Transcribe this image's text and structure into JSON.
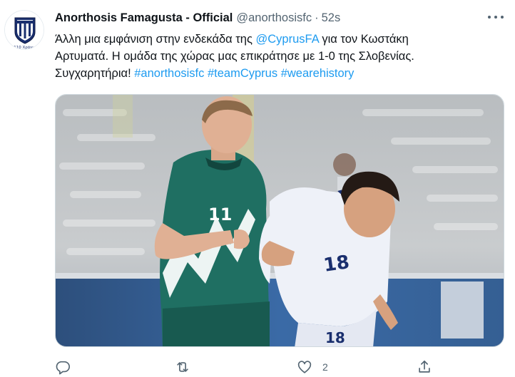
{
  "tweet": {
    "display_name": "Anorthosis Famagusta - Official",
    "handle": "@anorthosisfc",
    "separator": "·",
    "time": "52s",
    "text": {
      "l1_a": "Άλλη μια εμφάνιση στην ενδεκάδα της ",
      "l1_mention": "@CyprusFA",
      "l1_b": " για τον Κωστάκη",
      "l2": "Αρτυματά. Η ομάδα της χώρας μας επικράτησε με 1-0 της Σλοβενίας.",
      "l3_a": "Συγχαρητήρια! ",
      "hashtags": [
        "#anorthosisfc",
        "#teamCyprus",
        "#wearehistory"
      ]
    },
    "avatar": {
      "icon": "club-crest-icon",
      "caption": "110 Χρόνια"
    },
    "media": {
      "jersey_numbers": [
        "11",
        "18",
        "18"
      ]
    },
    "actions": {
      "reply_icon": "reply-icon",
      "retweet_icon": "retweet-icon",
      "like_icon": "heart-icon",
      "like_count": "2",
      "share_icon": "share-icon"
    },
    "colors": {
      "link": "#1d9bf0",
      "text": "#0f1419",
      "muted": "#536471",
      "slovenia_green": "#1f6f62",
      "cyprus_white": "#eef1f8"
    }
  }
}
